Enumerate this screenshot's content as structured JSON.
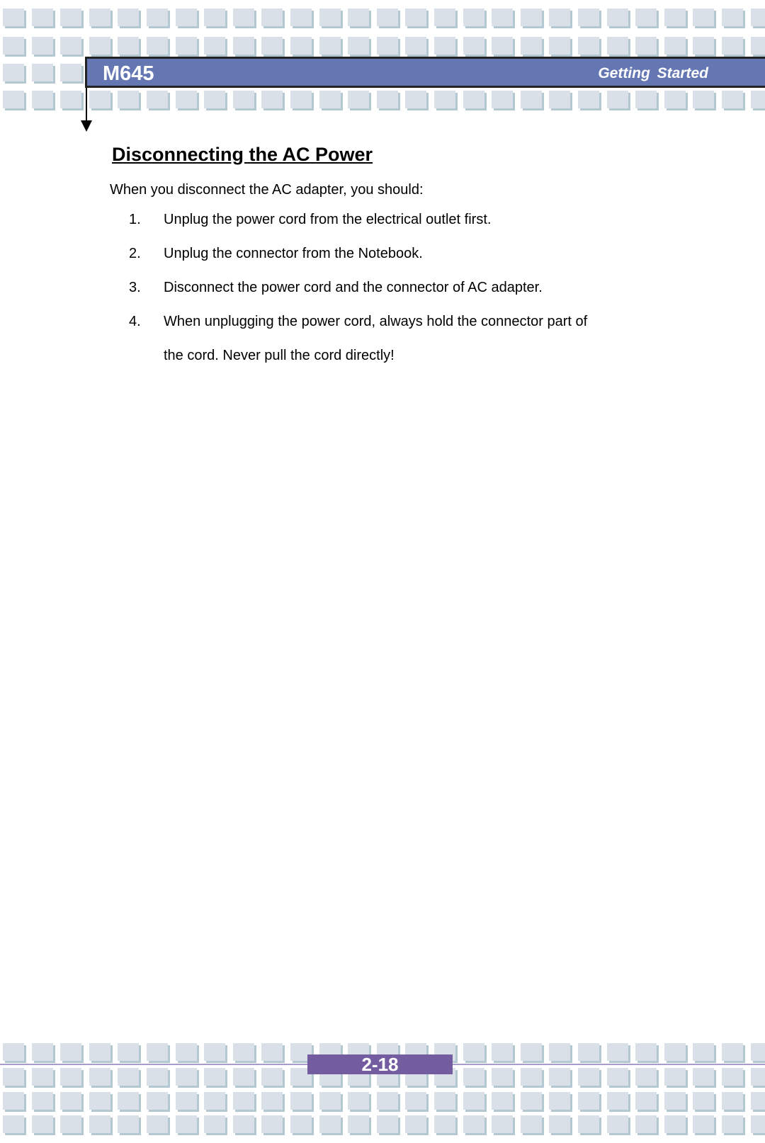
{
  "header": {
    "model": "M645",
    "section": "Getting  Started"
  },
  "content": {
    "title": "Disconnecting the AC Power",
    "intro": "When you disconnect the AC adapter, you should:",
    "steps": [
      {
        "number": "1.",
        "lines": [
          "Unplug the power cord from the electrical outlet first."
        ]
      },
      {
        "number": "2.",
        "lines": [
          "Unplug the connector from the Notebook."
        ]
      },
      {
        "number": "3.",
        "lines": [
          "Disconnect the power cord and the connector of AC adapter."
        ]
      },
      {
        "number": "4.",
        "lines": [
          "When unplugging the power cord, always hold the connector part of",
          "the cord. Never pull the cord directly!"
        ]
      }
    ]
  },
  "footer": {
    "page_number": "2-18"
  },
  "colors": {
    "header_bar": "#6577b3",
    "page_box": "#735da0",
    "tile": "#d9e0e7"
  }
}
